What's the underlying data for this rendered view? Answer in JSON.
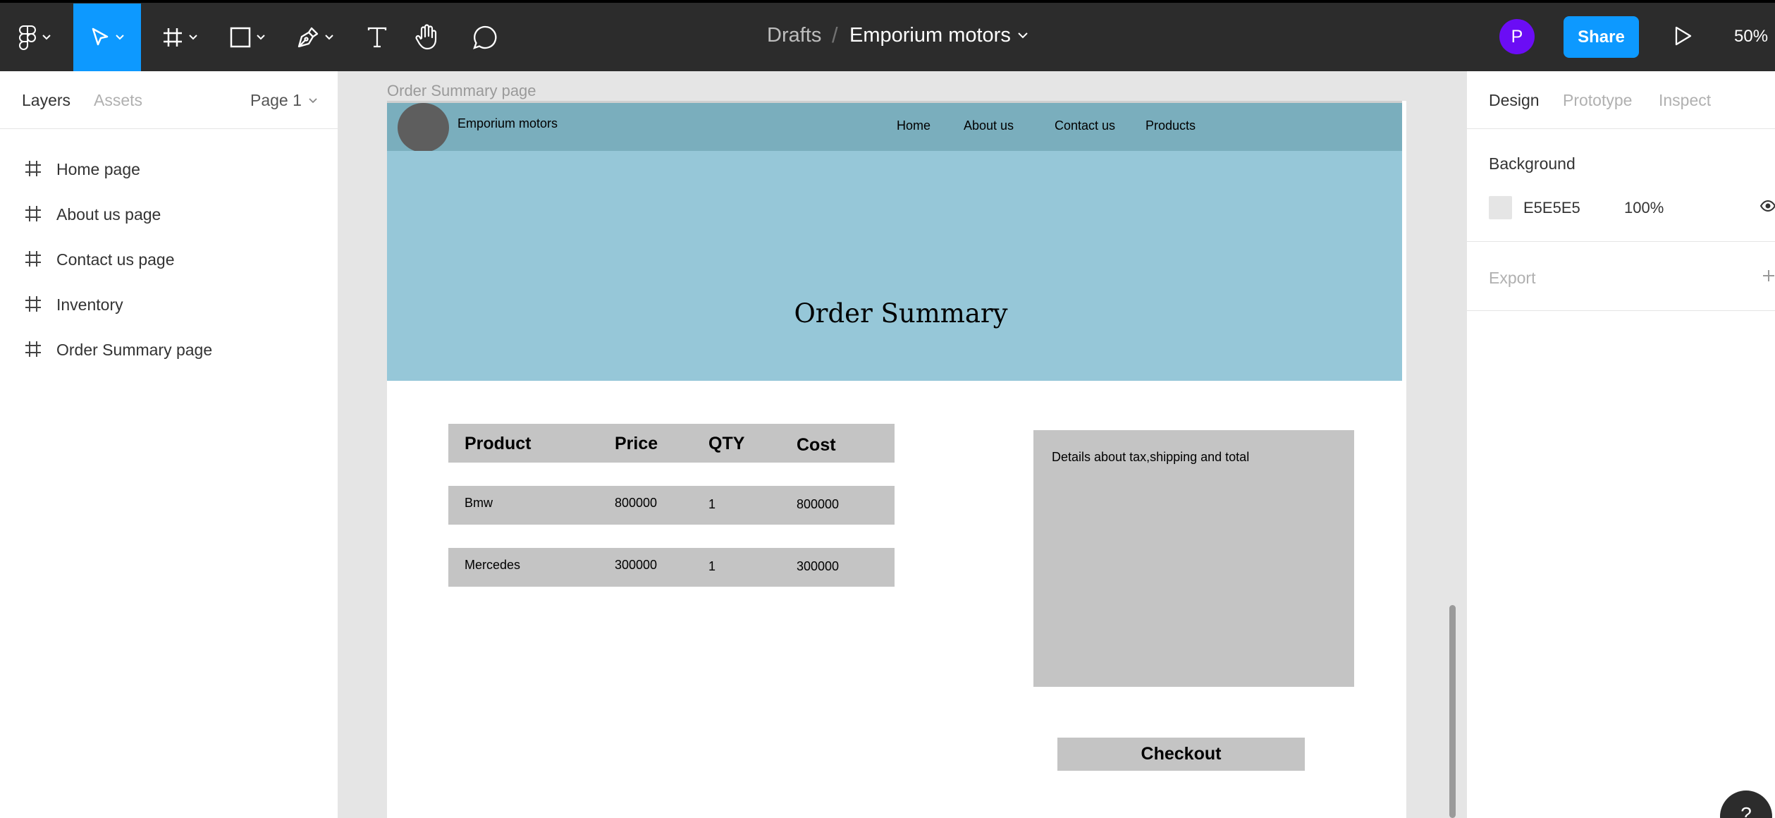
{
  "toolbar": {
    "breadcrumb_parent": "Drafts",
    "breadcrumb_separator": "/",
    "file_name": "Emporium motors",
    "avatar_initial": "P",
    "share_label": "Share",
    "zoom": "50%",
    "tools": [
      {
        "name": "main-menu",
        "icon": "figma-logo-icon"
      },
      {
        "name": "move-tool",
        "icon": "cursor-icon",
        "active": true
      },
      {
        "name": "frame-tool",
        "icon": "frame-hash-icon"
      },
      {
        "name": "shape-tool",
        "icon": "rectangle-icon"
      },
      {
        "name": "pen-tool",
        "icon": "pen-icon"
      },
      {
        "name": "text-tool",
        "icon": "text-T-icon"
      },
      {
        "name": "hand-tool",
        "icon": "hand-icon"
      },
      {
        "name": "comment-tool",
        "icon": "comment-bubble-icon"
      }
    ]
  },
  "left_panel": {
    "tabs": [
      "Layers",
      "Assets"
    ],
    "page": "Page 1",
    "layers": [
      "Home page",
      "About us page",
      "Contact us page",
      "Inventory",
      "Order Summary page"
    ]
  },
  "canvas": {
    "frame_label": "Order Summary page",
    "design": {
      "brand": "Emporium motors",
      "nav_links": [
        "Home",
        "About us",
        "Contact us",
        "Products"
      ],
      "hero_title": "Order Summary",
      "table": {
        "headers": [
          "Product",
          "Price",
          "QTY",
          "Cost"
        ],
        "rows": [
          [
            "Bmw",
            "800000",
            "1",
            "800000"
          ],
          [
            "Mercedes",
            "300000",
            "1",
            "300000"
          ]
        ]
      },
      "details_text": "Details about tax,shipping and total",
      "checkout_label": "Checkout"
    }
  },
  "right_panel": {
    "tabs": [
      "Design",
      "Prototype",
      "Inspect"
    ],
    "background_title": "Background",
    "background_hex": "E5E5E5",
    "background_opacity": "100%",
    "export_title": "Export"
  },
  "help_label": "?",
  "colors": {
    "toolbar_bg": "#2c2c2c",
    "accent": "#0d99ff",
    "avatar": "#6b0df5",
    "canvas_bg": "#e5e5e5",
    "nav_bg": "#7aaebd",
    "hero_bg": "#96c7d8",
    "block_gray": "#c4c4c4"
  }
}
